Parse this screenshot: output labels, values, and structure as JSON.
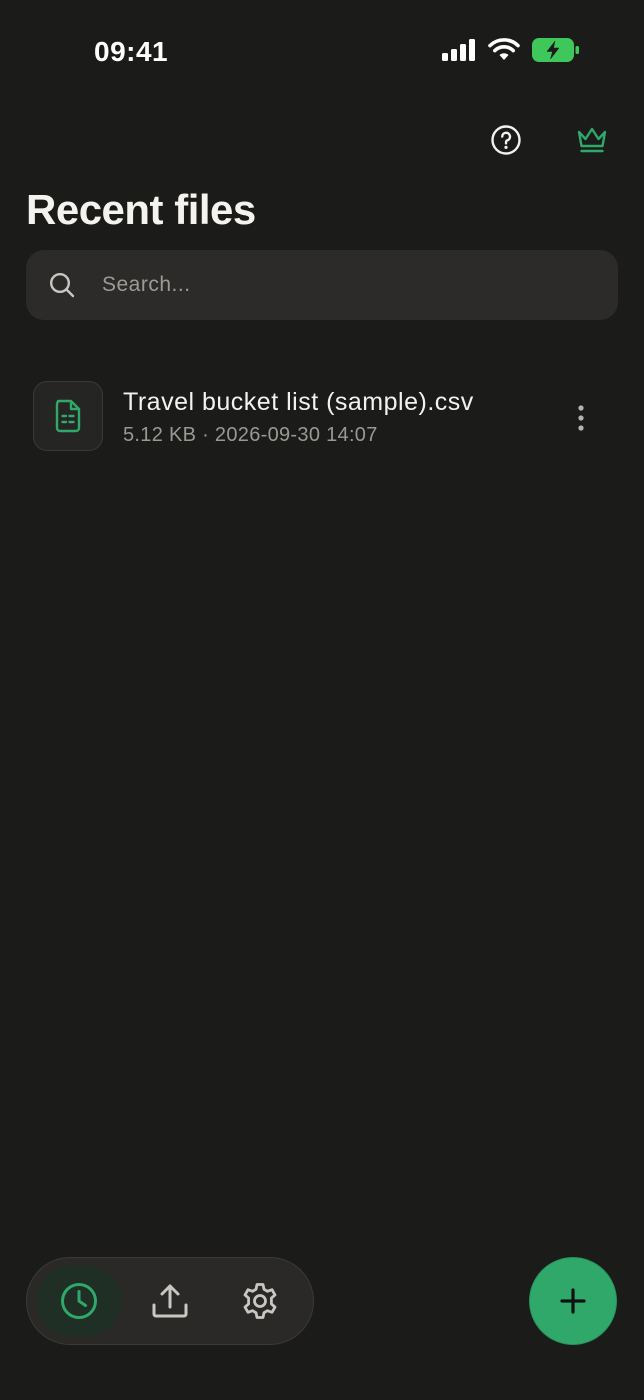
{
  "status_bar": {
    "time": "09:41"
  },
  "header": {
    "title": "Recent files",
    "help_icon": "help-circle-icon",
    "premium_icon": "crown-icon"
  },
  "search": {
    "placeholder": "Search...",
    "value": ""
  },
  "files": [
    {
      "name": "Travel bucket list (sample).csv",
      "meta": "5.12 KB · 2026-09-30 14:07",
      "icon": "spreadsheet-file-icon"
    }
  ],
  "bottom_nav": {
    "items": [
      {
        "icon": "clock-icon",
        "active": true
      },
      {
        "icon": "upload-icon",
        "active": false
      },
      {
        "icon": "gear-icon",
        "active": false
      }
    ]
  },
  "fab": {
    "icon": "plus-icon"
  },
  "colors": {
    "accent": "#2fa86a",
    "background": "#1b1b1a",
    "surface": "#2c2b29",
    "battery": "#3ec75a"
  }
}
